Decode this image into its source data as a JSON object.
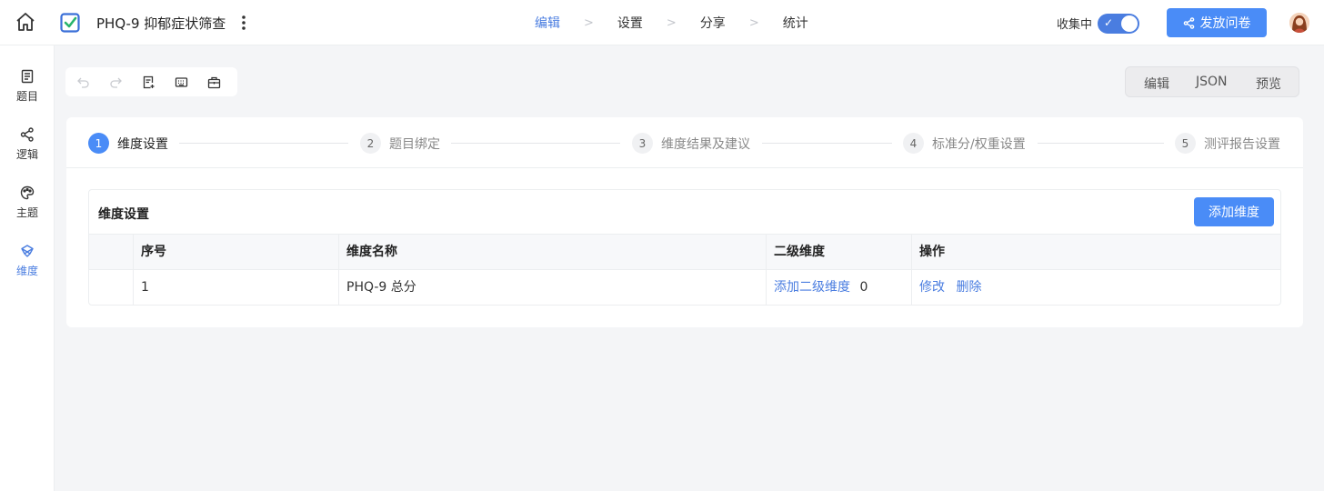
{
  "header": {
    "doc_title": "PHQ-9 抑郁症状筛查",
    "nav": [
      "编辑",
      "设置",
      "分享",
      "统计"
    ],
    "nav_active": 0,
    "collect_label": "收集中",
    "collect_on": true,
    "publish_label": "发放问卷"
  },
  "sidebar": {
    "items": [
      {
        "label": "题目",
        "icon": "list-icon"
      },
      {
        "label": "逻辑",
        "icon": "share-nodes-icon"
      },
      {
        "label": "主题",
        "icon": "palette-icon"
      },
      {
        "label": "维度",
        "icon": "cube-icon"
      }
    ],
    "active": 3
  },
  "viewswitch": [
    "编辑",
    "JSON",
    "预览"
  ],
  "steps": [
    {
      "num": "1",
      "label": "维度设置"
    },
    {
      "num": "2",
      "label": "题目绑定"
    },
    {
      "num": "3",
      "label": "维度结果及建议"
    },
    {
      "num": "4",
      "label": "标准分/权重设置"
    },
    {
      "num": "5",
      "label": "测评报告设置"
    }
  ],
  "active_step": 0,
  "panel": {
    "title": "维度设置",
    "add_label": "添加维度",
    "columns": [
      "",
      "序号",
      "维度名称",
      "二级维度",
      "操作"
    ],
    "rows": [
      {
        "index": "1",
        "name": "PHQ-9 总分",
        "sub_link": "添加二级维度",
        "sub_count": "0",
        "edit": "修改",
        "delete": "删除"
      }
    ]
  },
  "colors": {
    "accent": "#4a8cf7",
    "link": "#4a7de0"
  }
}
